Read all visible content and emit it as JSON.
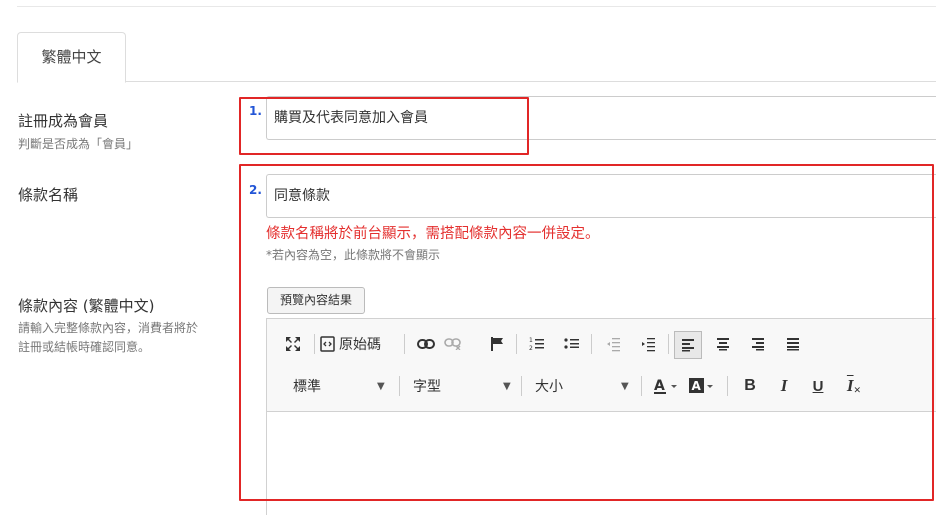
{
  "tabs": [
    {
      "label": "繁體中文"
    }
  ],
  "fields": {
    "member": {
      "label": "註冊成為會員",
      "sublabel": "判斷是否成為「會員」",
      "value": "購買及代表同意加入會員"
    },
    "terms_name": {
      "label": "條款名稱",
      "value": "同意條款",
      "hint_red": "條款名稱將於前台顯示，需搭配條款內容一併設定。",
      "hint_gray": "*若內容為空，此條款將不會顯示"
    },
    "terms_content": {
      "label": "條款內容 (繁體中文)",
      "sublabel_line1": "請輸入完整條款內容，消費者將於",
      "sublabel_line2": "註冊或結帳時確認同意。",
      "preview_button": "預覽內容結果"
    }
  },
  "editor": {
    "source_label": "原始碼",
    "format_select": "標準",
    "font_select": "字型",
    "size_select": "大小",
    "bold": "B",
    "italic": "I",
    "underline": "U",
    "clear_format": "I"
  },
  "annotations": [
    {
      "number": "1.",
      "color": "#2255d6"
    },
    {
      "number": "2.",
      "color": "#2255d6"
    }
  ],
  "colors": {
    "annotation_box": "#e12626",
    "hint_red": "#e4302f"
  }
}
